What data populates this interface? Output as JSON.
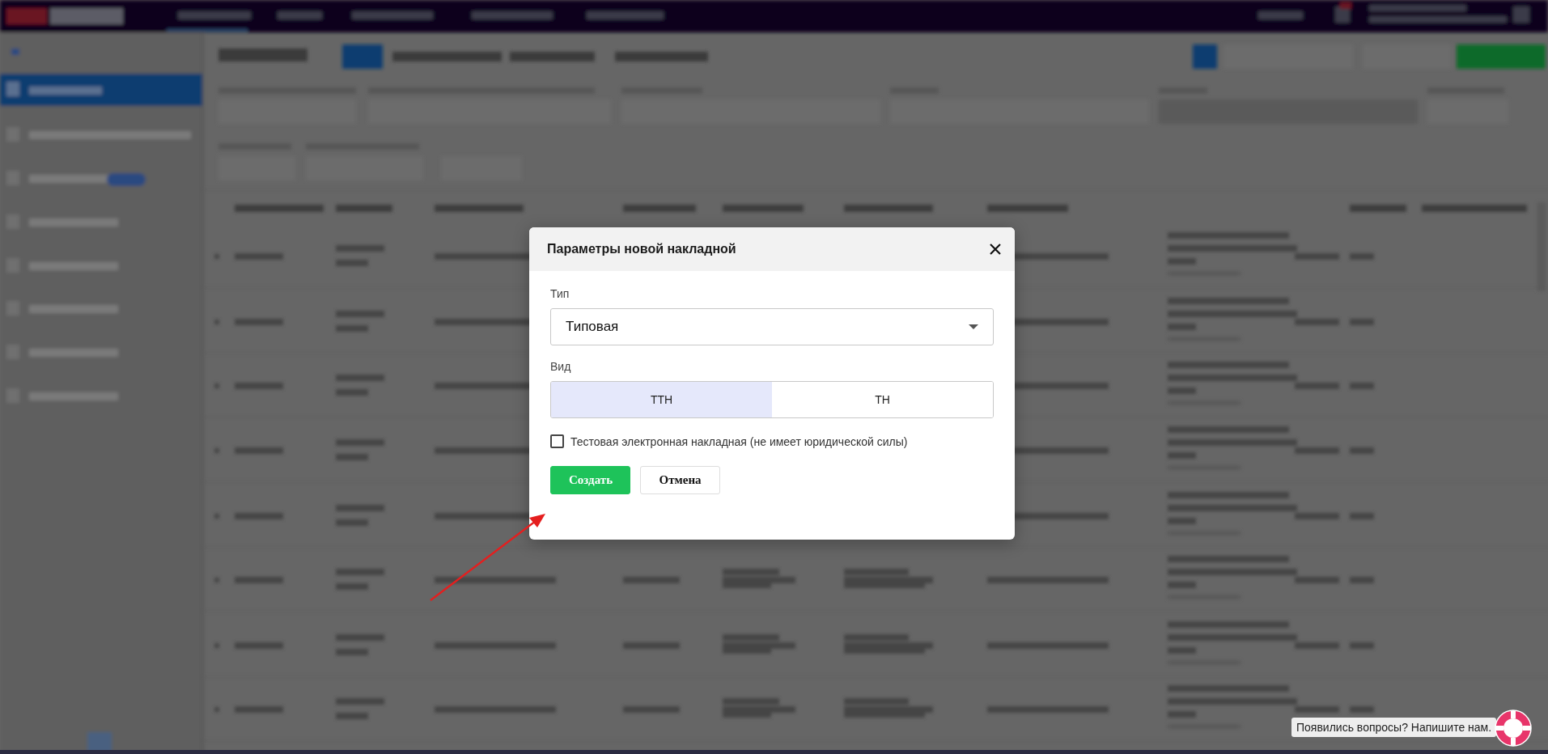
{
  "dialog": {
    "title": "Параметры новой накладной",
    "fields": [
      {
        "kind": "select",
        "label": "Тип",
        "value": "Типовая"
      },
      {
        "kind": "segmented",
        "label": "Вид",
        "options": [
          {
            "label": "ТТН",
            "selected": true
          },
          {
            "label": "ТН",
            "selected": false
          }
        ]
      }
    ],
    "checkbox": {
      "label": "Тестовая электронная накладная (не имеет юридической силы)",
      "checked": false
    },
    "buttons": [
      {
        "kind": "primary",
        "label": "Создать"
      },
      {
        "kind": "secondary",
        "label": "Отмена"
      }
    ]
  },
  "help_widget": {
    "text": "Появились вопросы? Напишите нам."
  }
}
